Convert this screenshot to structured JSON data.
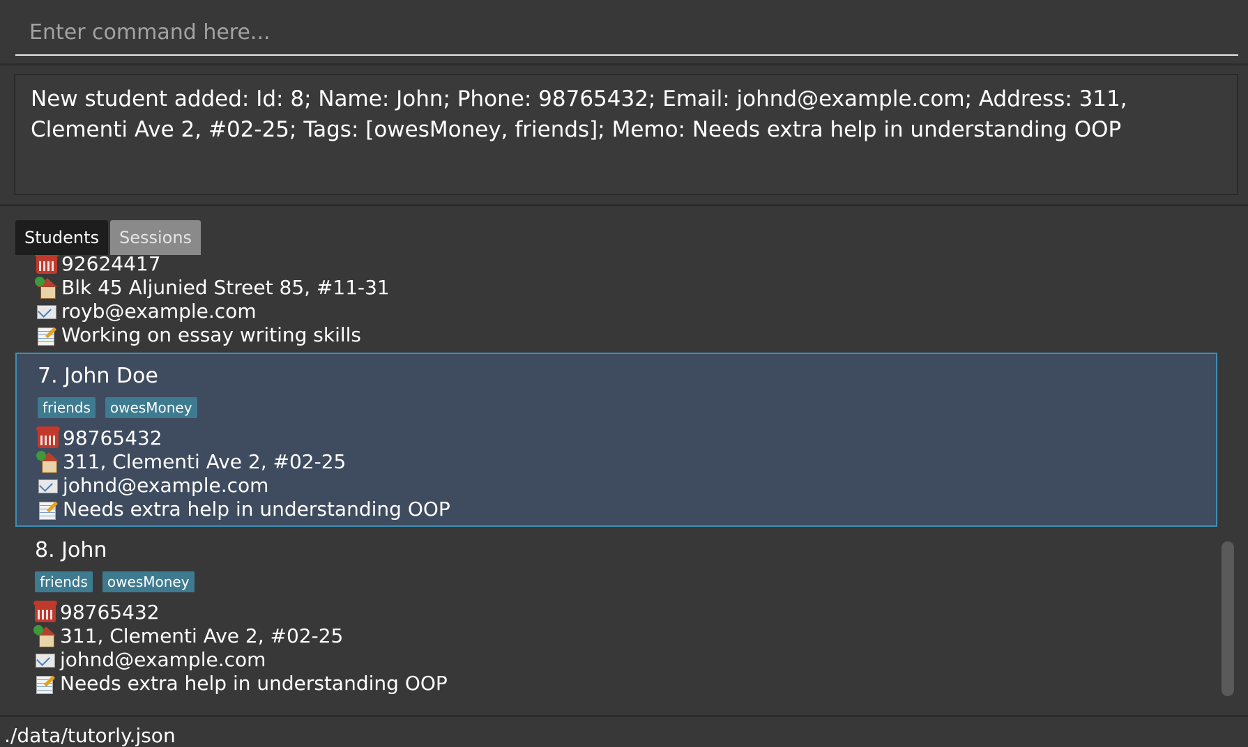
{
  "command": {
    "placeholder": "Enter command here..."
  },
  "result": {
    "message": "New student added: Id: 8; Name: John; Phone: 98765432; Email: johnd@example.com; Address: 311, Clementi Ave 2, #02-25; Tags: [owesMoney, friends]; Memo: Needs extra help in understanding OOP"
  },
  "tabs": [
    {
      "label": "Students",
      "active": true
    },
    {
      "label": "Sessions",
      "active": false
    }
  ],
  "students": [
    {
      "phone": "92624417",
      "address": "Blk 45 Aljunied Street 85, #11-31",
      "email": "royb@example.com",
      "memo": "Working on essay writing skills"
    },
    {
      "title": "7. John Doe",
      "tags": [
        "friends",
        "owesMoney"
      ],
      "phone": "98765432",
      "address": "311, Clementi Ave 2, #02-25",
      "email": "johnd@example.com",
      "memo": "Needs extra help in understanding OOP",
      "selected": true
    },
    {
      "title": "8. John",
      "tags": [
        "friends",
        "owesMoney"
      ],
      "phone": "98765432",
      "address": "311, Clementi Ave 2, #02-25",
      "email": "johnd@example.com",
      "memo": "Needs extra help in understanding OOP"
    }
  ],
  "status": {
    "path": "./data/tutorly.json"
  },
  "icons": {
    "phone": "telephone-icon",
    "address": "house-icon",
    "email": "envelope-icon",
    "memo": "memo-icon"
  },
  "colors": {
    "background": "#383838",
    "selected_card": "#3f4b5f",
    "selected_border": "#3c8fb5",
    "tag": "#3e7b91",
    "tab_active": "#1d1d1d",
    "tab_inactive": "#8a8a8a"
  }
}
